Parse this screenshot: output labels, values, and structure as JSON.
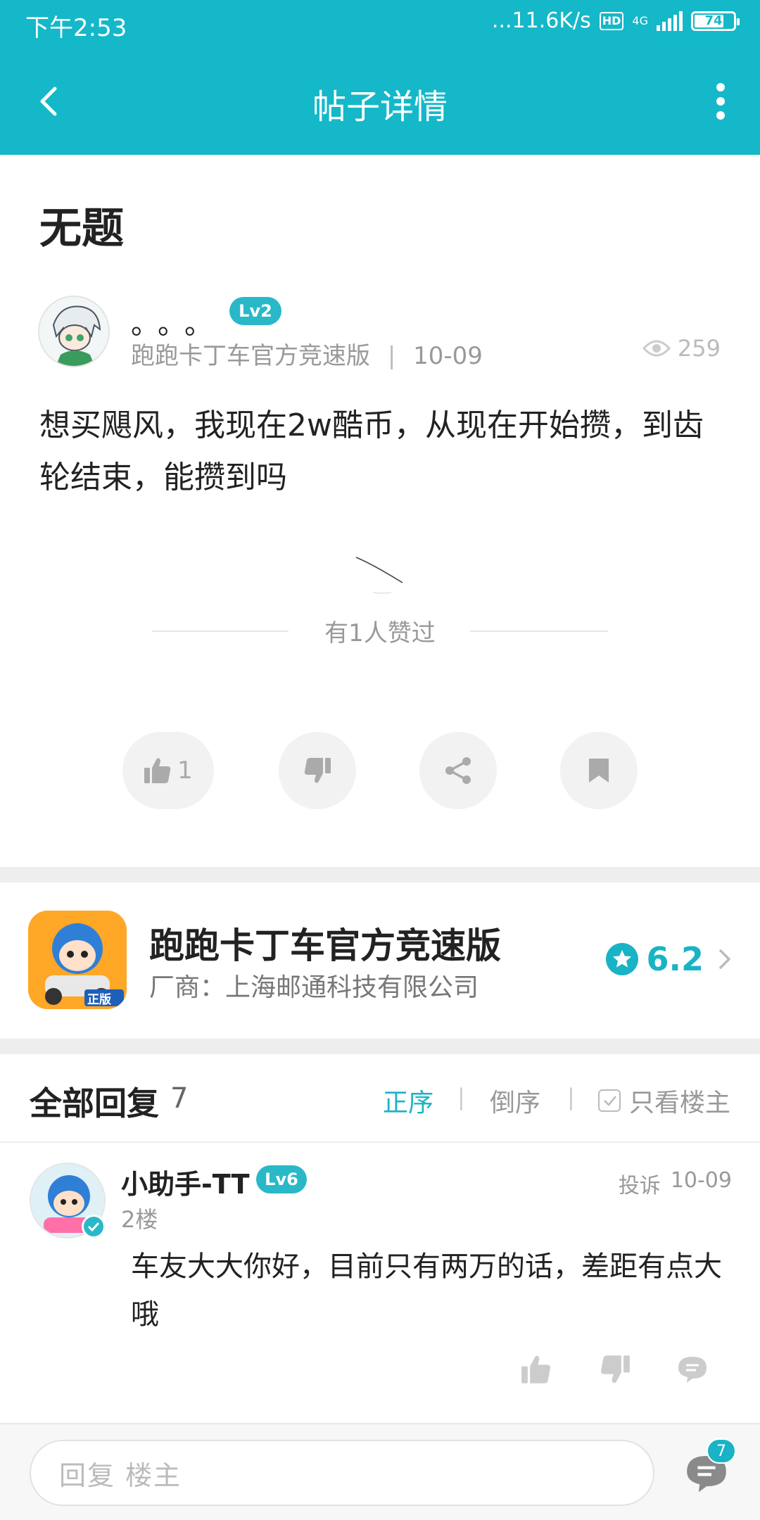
{
  "status_bar": {
    "time": "下午2:53",
    "speed": "...11.6K/s",
    "hd": "HD",
    "network": "4G",
    "battery": "74"
  },
  "header": {
    "title": "帖子详情"
  },
  "post": {
    "title": "无题",
    "author": "。。。",
    "level": "Lv2",
    "source": "跑跑卡丁车官方竞速版",
    "divider": "|",
    "date": "10-09",
    "views": "259",
    "content": "想买飓风，我现在2w酷币，从现在开始攒，到齿轮结束，能攒到吗",
    "liked_text": "有1人赞过",
    "like_count": "1"
  },
  "game": {
    "name": "跑跑卡丁车官方竞速版",
    "vendor": "厂商：上海邮通科技有限公司",
    "rating": "6.2",
    "badge": "正版"
  },
  "replies": {
    "title": "全部回复",
    "count": "7",
    "sort_asc": "正序",
    "sort_desc": "倒序",
    "only_host": "只看楼主",
    "items": [
      {
        "name": "小助手-TT",
        "level": "Lv6",
        "floor": "2楼",
        "report": "投诉",
        "date": "10-09",
        "text": "车友大大你好，目前只有两万的话，差距有点大哦"
      }
    ]
  },
  "bottom": {
    "placeholder": "回复  楼主",
    "comment_count": "7"
  },
  "colors": {
    "accent": "#14b8c8",
    "rating": "#1ab3c6"
  }
}
